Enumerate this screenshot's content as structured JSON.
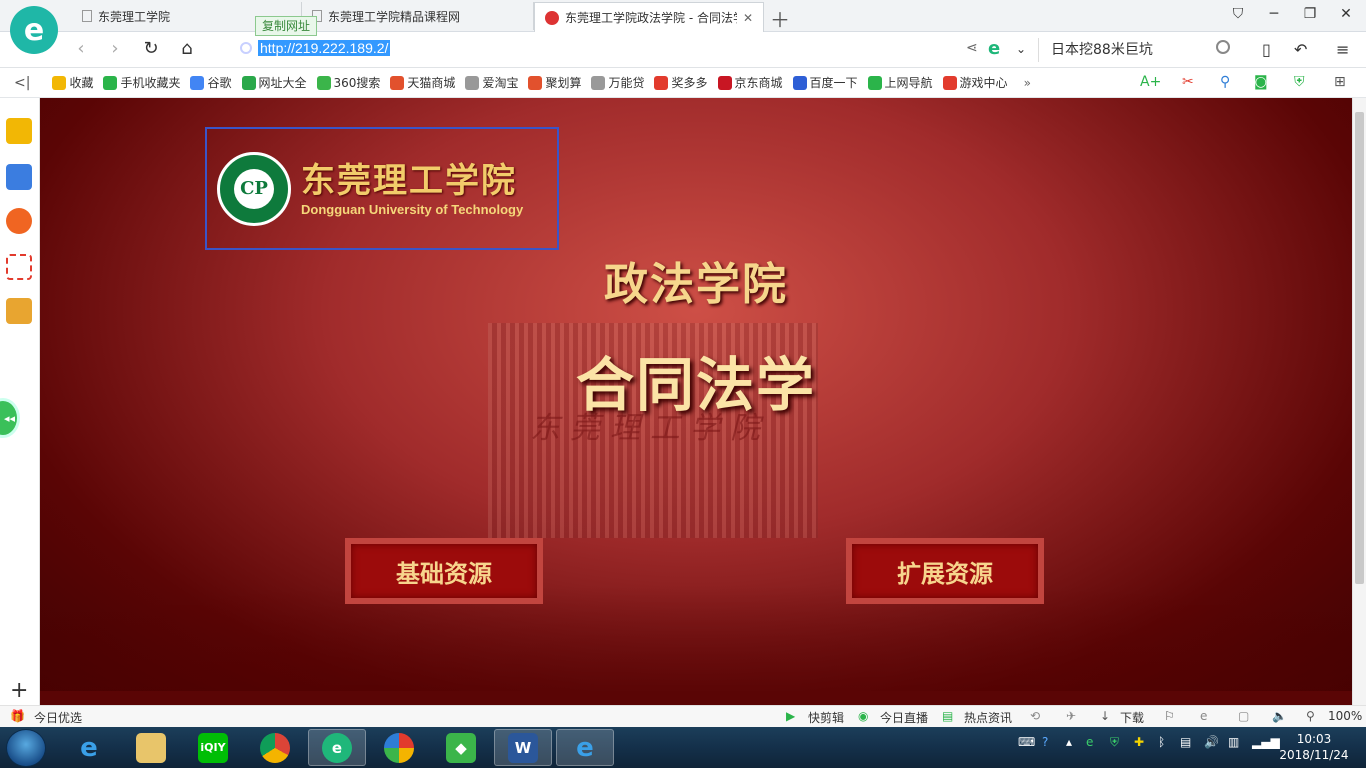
{
  "tabs": [
    {
      "label": "东莞理工学院"
    },
    {
      "label": "东莞理工学院精品课程网"
    },
    {
      "label": "东莞理工学院政法学院 - 合同法学"
    }
  ],
  "address": {
    "copy_badge": "复制网址",
    "url": "http://219.222.189.2/",
    "search_text": "日本挖88米巨坑"
  },
  "bookmarks": [
    {
      "label": "收藏",
      "color": "#f2b705"
    },
    {
      "label": "手机收藏夹",
      "color": "#2bb44a"
    },
    {
      "label": "谷歌",
      "color": "#4285f4"
    },
    {
      "label": "网址大全",
      "color": "#2aa84a"
    },
    {
      "label": "360搜索",
      "color": "#3bb54a"
    },
    {
      "label": "天猫商城",
      "color": "#e2512d"
    },
    {
      "label": "爱淘宝",
      "color": "#999999"
    },
    {
      "label": "聚划算",
      "color": "#e2512d"
    },
    {
      "label": "万能贷",
      "color": "#999999"
    },
    {
      "label": "奖多多",
      "color": "#e23b2d"
    },
    {
      "label": "京东商城",
      "color": "#c81623"
    },
    {
      "label": "百度一下",
      "color": "#2e5fd6"
    },
    {
      "label": "上网导航",
      "color": "#2bb44a"
    },
    {
      "label": "游戏中心",
      "color": "#e23b2d"
    }
  ],
  "page": {
    "school_cn": "东莞理工学院",
    "school_en": "Dongguan University of Technology",
    "seal_text": "CP",
    "college": "政法学院",
    "course": "合同法学",
    "building_text": "东莞理工学院",
    "btn_basic": "基础资源",
    "btn_extended": "扩展资源"
  },
  "statusbar": {
    "today_pick": "今日优选",
    "quick_clip": "快剪辑",
    "live_today": "今日直播",
    "hot_news": "热点资讯",
    "download": "下载",
    "zoom": "100%"
  },
  "clock": {
    "time": "10:03",
    "date": "2018/11/24"
  },
  "colors": {
    "accent_blue": "#3399ff",
    "brand_green": "#1fb7a7",
    "page_red": "#9c0b0b",
    "gold_text": "#f6d68c"
  }
}
